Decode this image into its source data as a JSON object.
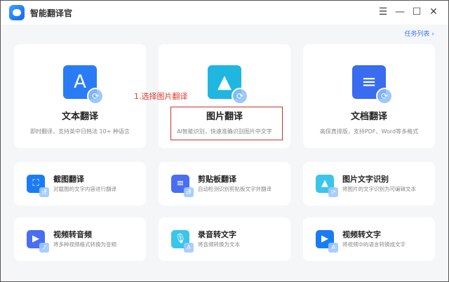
{
  "app": {
    "title": "智能翻译官"
  },
  "header": {
    "task_list": "任务列表 ›"
  },
  "main_features": [
    {
      "title": "文本翻译",
      "desc": "即时翻译，支持英中日韩法 10+ 种语言",
      "icon": "A",
      "color": "#2a7cf6"
    },
    {
      "title": "图片翻译",
      "desc": "AI智能识别，快速准确识别图片中文字",
      "icon": "▲",
      "color": "#1fb6e0"
    },
    {
      "title": "文档翻译",
      "desc": "高保真排版，支持PDF、Word等多格式",
      "icon": "≡",
      "color": "#3a6cf0"
    }
  ],
  "tools": [
    {
      "title": "截图翻译",
      "desc": "对截图的文字内容进行翻译",
      "icon": "⛶",
      "badge": "译",
      "color": "#1a7cf5"
    },
    {
      "title": "剪贴板翻译",
      "desc": "自动检测识别剪贴板文字并翻译",
      "icon": "≡",
      "badge": "译",
      "color": "#4a6ef0"
    },
    {
      "title": "图片文字识别",
      "desc": "将图片的文字识别为可编辑文本",
      "icon": "▲",
      "badge": "⟳",
      "color": "#3cc5ea"
    },
    {
      "title": "视频转音频",
      "desc": "将多种视频格式转换为音频",
      "icon": "▶",
      "badge": "♪",
      "color": "#4a6ef0"
    },
    {
      "title": "录音转文字",
      "desc": "将音频转换为文本",
      "icon": "🎙",
      "badge": "A",
      "color": "#3cc5ea"
    },
    {
      "title": "视频转文字",
      "desc": "将视频中的语言转换成文字",
      "icon": "▶",
      "badge": "A",
      "color": "#1a7cf5"
    }
  ],
  "annotation": "1.选择图片翻译"
}
